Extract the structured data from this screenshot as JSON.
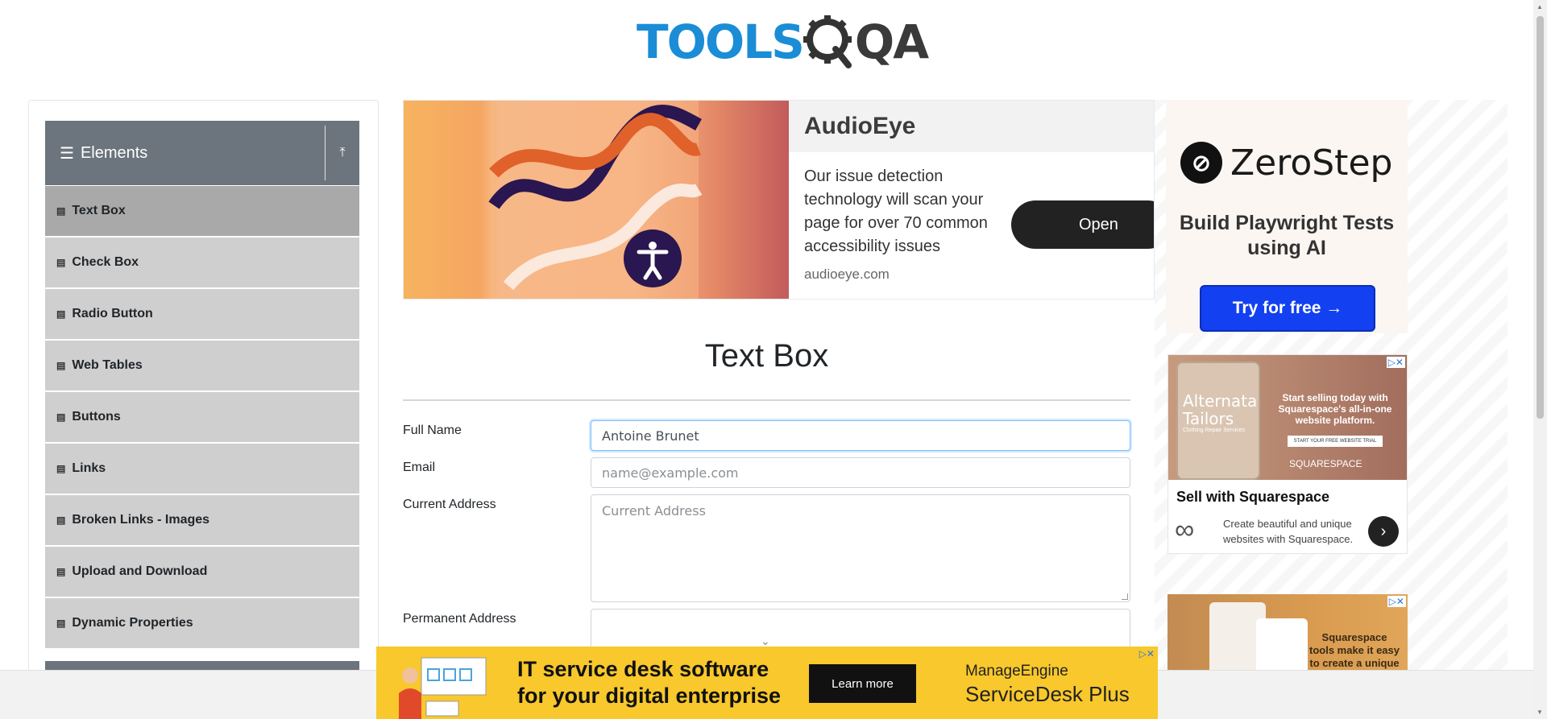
{
  "header": {
    "logo_part1": "TOOLS",
    "logo_part2": "QA"
  },
  "sidebar": {
    "group_title": "Elements",
    "items": [
      {
        "label": "Text Box",
        "active": true
      },
      {
        "label": "Check Box",
        "active": false
      },
      {
        "label": "Radio Button",
        "active": false
      },
      {
        "label": "Web Tables",
        "active": false
      },
      {
        "label": "Buttons",
        "active": false
      },
      {
        "label": "Links",
        "active": false
      },
      {
        "label": "Broken Links - Images",
        "active": false
      },
      {
        "label": "Upload and Download",
        "active": false
      },
      {
        "label": "Dynamic Properties",
        "active": false
      }
    ]
  },
  "ad_top": {
    "brand": "AudioEye",
    "description": "Our issue detection technology will scan your page for over 70 common accessibility issues",
    "domain": "audioeye.com",
    "cta": "Open"
  },
  "main": {
    "title": "Text Box",
    "fields": {
      "full_name_label": "Full Name",
      "full_name_value": "Antoine Brunet",
      "email_label": "Email",
      "email_placeholder": "name@example.com",
      "current_address_label": "Current Address",
      "current_address_placeholder": "Current Address",
      "permanent_address_label": "Permanent Address"
    }
  },
  "ad_zerostep": {
    "brand": "ZeroStep",
    "tagline": "Build Playwright Tests using AI",
    "cta": "Try for free →"
  },
  "ad_squarespace1": {
    "phone_brand": "Alternata Tailors",
    "phone_sub": "Clothing Repair Services",
    "promo": "Start selling today with Squarespace's all-in-one website platform.",
    "promo_cta": "START YOUR FREE WEBSITE TRIAL",
    "brand_small": "SQUARESPACE",
    "title": "Sell with Squarespace",
    "description": "Create beautiful and unique websites with Squarespace."
  },
  "ad_squarespace2": {
    "text": "Squarespace tools make it easy to create a unique website."
  },
  "ad_bottom": {
    "headline_line1": "IT service desk software",
    "headline_line2": "for your digital enterprise",
    "cta": "Learn more",
    "brand": "ManageEngine",
    "product": "ServiceDesk Plus"
  },
  "colors": {
    "logo_blue": "#1a8dd6",
    "sidebar_header": "#6c757d",
    "menu_item": "#cfcfcf",
    "menu_item_active": "#a9a9a9",
    "zerostep_button": "#1340f0",
    "bottom_ad_bg": "#f8c82c"
  }
}
